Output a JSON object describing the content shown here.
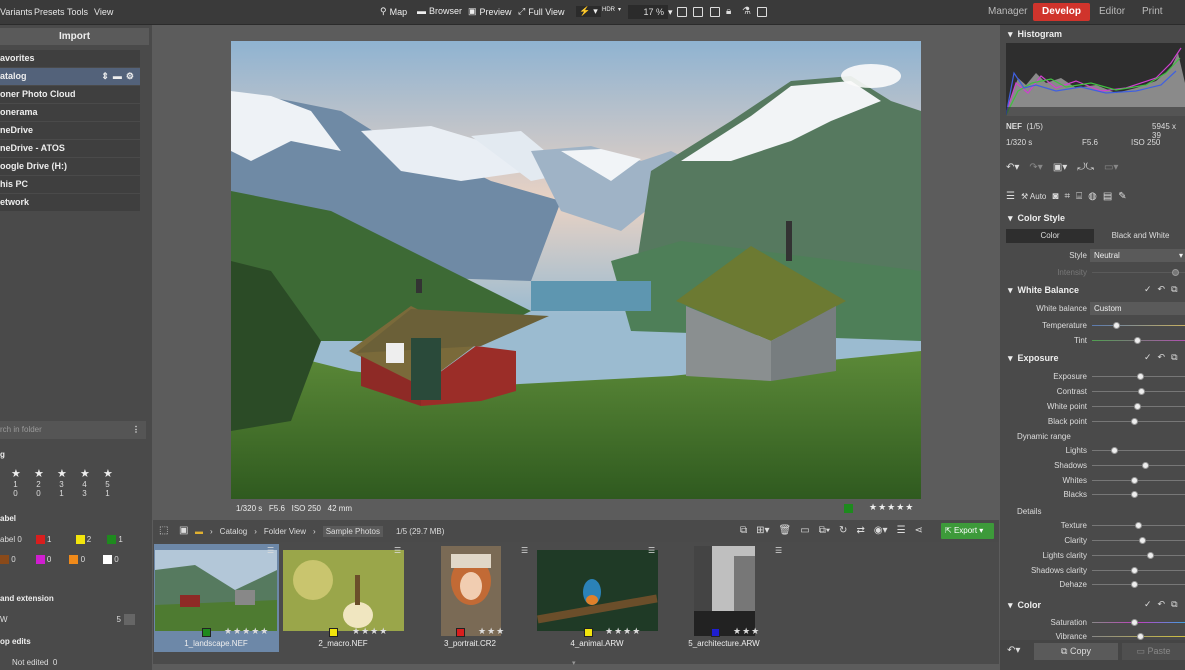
{
  "menu": [
    "Variants",
    "Presets",
    "Tools",
    "View"
  ],
  "toolbar": {
    "map": "Map",
    "browser": "Browser",
    "preview": "Preview",
    "fullview": "Full View",
    "zoom": "17 %",
    "hdr": "HDR"
  },
  "modes": {
    "manager": "Manager",
    "develop": "Develop",
    "editor": "Editor",
    "print": "Print"
  },
  "left": {
    "import": "Import",
    "folders": [
      "avorites",
      "atalog",
      "oner Photo Cloud",
      "onerama",
      "neDrive",
      "neDrive - ATOS",
      "oogle Drive (H:)",
      "his PC",
      "etwork"
    ],
    "search_placeholder": "rch in folder",
    "rating_head": "g",
    "rating_nums": [
      "1",
      "2",
      "3",
      "4",
      "5"
    ],
    "rating_counts": [
      "0",
      "0",
      "1",
      "3",
      "1"
    ],
    "label_head": "abel",
    "label_prefix": "abel",
    "label_counts_row1": [
      "0",
      "1",
      "2",
      "1"
    ],
    "label_counts_row2": [
      "0",
      "0",
      "0",
      "0"
    ],
    "ext_head": "and extension",
    "ext_item": "W",
    "ext_count": "5",
    "edits_head": "op edits",
    "not_edited": "Not edited",
    "not_edited_count": "0"
  },
  "colors": {
    "red": "#d81e1e",
    "yellow": "#f2e50c",
    "green": "#1e8a1e",
    "brown": "#8a4a1a",
    "magenta": "#d01ed0",
    "orange": "#f08a1a",
    "white": "#ffffff",
    "blue": "#1e1ed0",
    "accent": "#d0342c"
  },
  "photo_info": {
    "shutter": "1/320 s",
    "aperture": "F5.6",
    "iso": "ISO 250",
    "focal": "42 mm"
  },
  "photo_rating_stars": "★★★★★",
  "breadcrumb": {
    "catalog": "Catalog",
    "folderview": "Folder View",
    "sample": "Sample Photos",
    "count": "1/5 (29.7 MB)"
  },
  "export": "Export",
  "thumbs": [
    {
      "name": "1_landscape.NEF",
      "stars": "★★★★★",
      "label": "green"
    },
    {
      "name": "2_macro.NEF",
      "stars": "★★★★",
      "label": "yellow"
    },
    {
      "name": "3_portrait.CR2",
      "stars": "★★★",
      "label": "red"
    },
    {
      "name": "4_animal.ARW",
      "stars": "★★★★",
      "label": "yellow"
    },
    {
      "name": "5_architecture.ARW",
      "stars": "★★★",
      "label": "blue"
    }
  ],
  "right": {
    "histogram": "Histogram",
    "nef": "NEF",
    "nef_count": "(1/5)",
    "dims": "5945 x 39",
    "shutter": "1/320 s",
    "aperture": "F5.6",
    "iso": "ISO 250",
    "auto": "Auto",
    "colorstyle": "Color Style",
    "color_tab": "Color",
    "bw_tab": "Black and White",
    "style_label": "Style",
    "style_value": "Neutral",
    "intensity": "Intensity",
    "wb": "White Balance",
    "wb_label": "White balance",
    "wb_value": "Custom",
    "temperature": "Temperature",
    "tint": "Tint",
    "exposure_head": "Exposure",
    "exposure": "Exposure",
    "contrast": "Contrast",
    "whitepoint": "White point",
    "blackpoint": "Black point",
    "dynrange": "Dynamic range",
    "lights": "Lights",
    "shadows": "Shadows",
    "whites": "Whites",
    "blacks": "Blacks",
    "details": "Details",
    "texture": "Texture",
    "clarity": "Clarity",
    "lightsclarity": "Lights clarity",
    "shadowsclarity": "Shadows clarity",
    "dehaze": "Dehaze",
    "color_head": "Color",
    "saturation": "Saturation",
    "vibrance": "Vibrance",
    "copy": "Copy",
    "paste": "Paste"
  }
}
